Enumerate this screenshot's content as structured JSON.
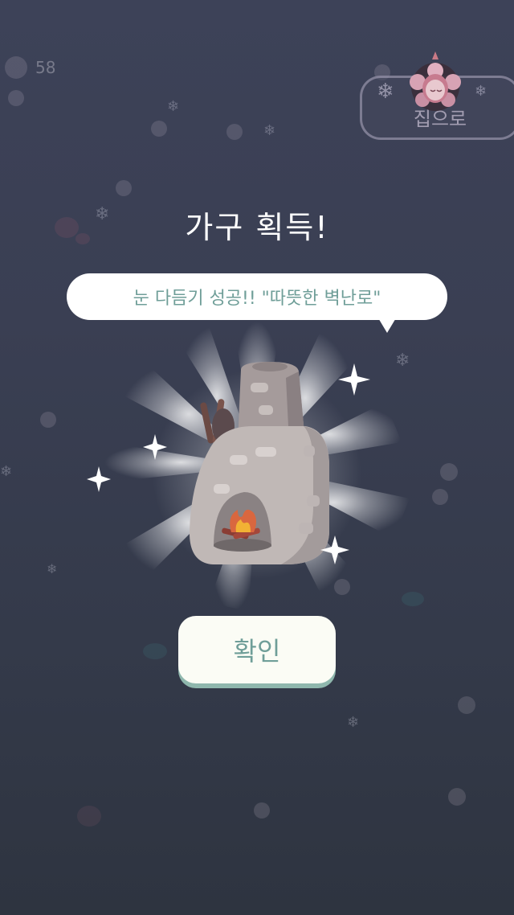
{
  "hud": {
    "counter": "58"
  },
  "home_button": {
    "label": "집으로"
  },
  "dialog": {
    "title": "가구 획득!",
    "message": "눈 다듬기 성공!! \"따뜻한 벽난로\"",
    "confirm_label": "확인"
  },
  "icons": [
    "snowflake-icon",
    "sparkle-icon",
    "fireplace-icon",
    "character-avatar-icon"
  ],
  "colors": {
    "background": "#3a3f53",
    "bubble_text": "#6f9e98",
    "button_face": "#fbfcf5",
    "button_shadow": "#8fb7ad",
    "title_text": "#ffffff"
  }
}
